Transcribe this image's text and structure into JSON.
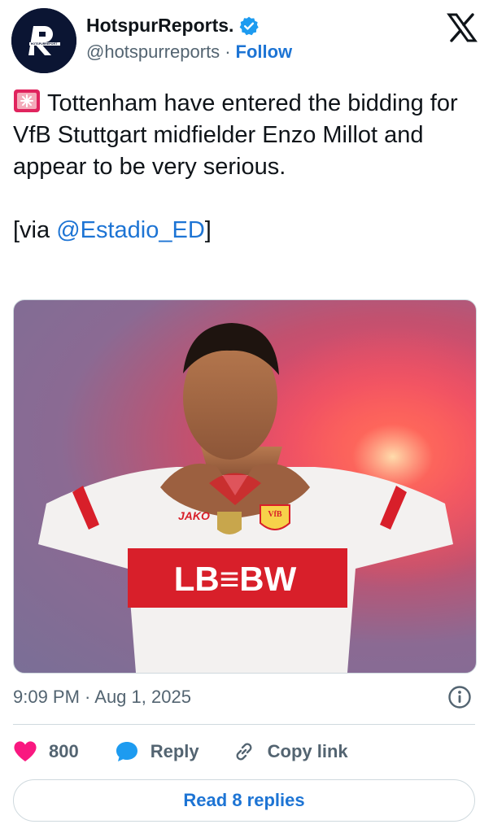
{
  "account": {
    "display_name": "HotspurReports.",
    "handle": "@hotspurreports",
    "separator": "·",
    "follow_label": "Follow",
    "avatar_text": "HOTSPURREPORT",
    "verified": true
  },
  "tweet": {
    "text": "Tottenham have entered the bidding for VfB Stuttgart midfielder Enzo Millot and appear to be very serious.",
    "via_open": "[via ",
    "via_mention": "@Estadio_ED",
    "via_close": "]",
    "leading_emoji": "police-siren-icon"
  },
  "media": {
    "shirt_sponsor": "LB≡BW",
    "kit_brand": "JAKO",
    "crest_text": "VfB"
  },
  "meta": {
    "timestamp": "9:09 PM · Aug 1, 2025"
  },
  "actions": {
    "likes_count": "800",
    "reply_label": "Reply",
    "copy_link_label": "Copy link"
  },
  "footer": {
    "read_replies_label": "Read 8 replies"
  },
  "colors": {
    "link_blue": "#1d74d4",
    "like_pink": "#f91880",
    "reply_blue": "#1d9bf0",
    "muted": "#536471",
    "border": "#cfd9de"
  }
}
